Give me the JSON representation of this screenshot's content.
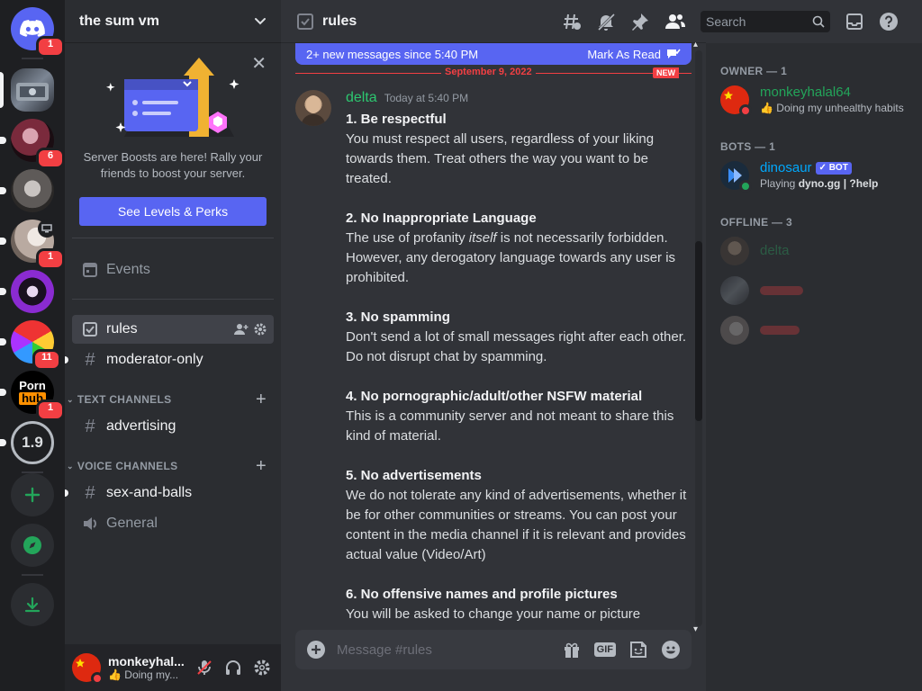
{
  "servers": {
    "home_badge": "1",
    "items": [
      {
        "badge": ""
      },
      {
        "badge": "6"
      },
      {
        "badge": ""
      },
      {
        "badge": "1"
      },
      {
        "badge": ""
      },
      {
        "badge": "11"
      },
      {
        "badge": "1",
        "logo_top": "Porn",
        "logo_bottom": "hub"
      },
      {
        "badge": "",
        "label": "1.9"
      }
    ]
  },
  "guild": {
    "name": "the sum vm"
  },
  "boost": {
    "text": "Server Boosts are here! Rally your friends to boost your server.",
    "button": "See Levels & Perks"
  },
  "sidebar": {
    "events": "Events",
    "channels_top": [
      {
        "name": "rules"
      },
      {
        "name": "moderator-only"
      }
    ],
    "text_category": "TEXT CHANNELS",
    "text_channels": [
      {
        "name": "advertising"
      }
    ],
    "voice_category": "VOICE CHANNELS",
    "voice_channels": [
      {
        "name": "sex-and-balls"
      },
      {
        "name": "General"
      }
    ]
  },
  "user": {
    "name": "monkeyhal...",
    "status": "👍 Doing my..."
  },
  "channel": {
    "name": "rules"
  },
  "search": {
    "placeholder": "Search"
  },
  "newbar": {
    "text": "2+ new messages since 5:40 PM",
    "action": "Mark As Read"
  },
  "divider": {
    "date": "September 9, 2022",
    "new": "NEW"
  },
  "message": {
    "author": "delta",
    "time": "Today at 5:40 PM",
    "rules": [
      {
        "title": "1. Be respectful",
        "text": "You must respect all users, regardless of your liking towards them. Treat others the way you want to be treated."
      },
      {
        "title": "2. No Inappropriate Language",
        "text_a": "The use of profanity ",
        "text_em": "itself",
        "text_b": " is not necessarily forbidden. However, any derogatory language towards any user is prohibited."
      },
      {
        "title": "3. No spamming",
        "text": "Don't send a lot of small messages right after each other. Do not disrupt chat by spamming."
      },
      {
        "title": "4. No pornographic/adult/other NSFW material",
        "text": "This is a community server and not meant to share this kind of material."
      },
      {
        "title": "5. No advertisements",
        "text": "We do not tolerate any kind of advertisements, whether it be for other communities or streams. You can post your content in the media channel if it is relevant and provides actual value (Video/Art)"
      },
      {
        "title": "6. No offensive names and profile pictures",
        "text": "You will be asked to change your name or picture"
      }
    ]
  },
  "composer": {
    "placeholder": "Message #rules",
    "gif": "GIF"
  },
  "members": {
    "owner_header": "OWNER — 1",
    "owner": {
      "name": "monkeyhalal64",
      "status": "👍 Doing my unhealthy habits"
    },
    "bots_header": "BOTS — 1",
    "bot": {
      "name": "dinosaur",
      "tag": "✓ BOT",
      "status_prefix": "Playing ",
      "status_game": "dyno.gg | ?help"
    },
    "offline_header": "OFFLINE — 3",
    "offline": [
      {
        "name": "delta"
      },
      {
        "name": ""
      },
      {
        "name": ""
      }
    ]
  },
  "colors": {
    "blurple": "#5865f2",
    "red": "#f23f43",
    "green": "#23a55a",
    "author_green": "#2dc770",
    "bot_blue": "#00a8fc"
  }
}
